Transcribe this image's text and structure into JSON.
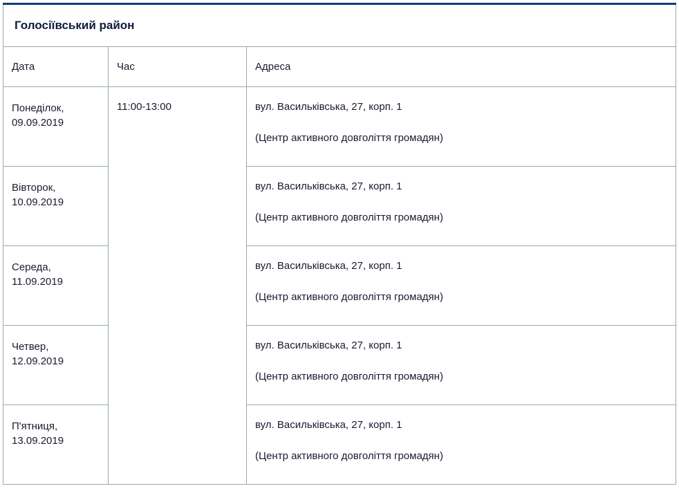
{
  "district_title": "Голосіївський район",
  "headers": {
    "date": "Дата",
    "time": "Час",
    "address": "Адреса"
  },
  "time_value": "11:00-13:00",
  "rows": [
    {
      "date_line1": "Понеділок,",
      "date_line2": "09.09.2019",
      "addr1": "вул. Васильківська, 27, корп. 1",
      "addr2": "(Центр активного довголіття громадян)"
    },
    {
      "date_line1": "Вівторок,",
      "date_line2": "10.09.2019",
      "addr1": "вул. Васильківська, 27, корп. 1",
      "addr2": "(Центр активного довголіття громадян)"
    },
    {
      "date_line1": "Середа, 11.09.2019",
      "date_line2": "",
      "addr1": "вул. Васильківська, 27, корп. 1",
      "addr2": "(Центр активного довголіття громадян)"
    },
    {
      "date_line1": "Четвер, 12.09.2019",
      "date_line2": "",
      "addr1": "вул. Васильківська, 27, корп. 1",
      "addr2": "(Центр активного довголіття громадян)"
    },
    {
      "date_line1": "П'ятниця,",
      "date_line2": "13.09.2019",
      "addr1": "вул. Васильківська, 27, корп. 1",
      "addr2": "(Центр активного довголіття громадян)"
    }
  ]
}
